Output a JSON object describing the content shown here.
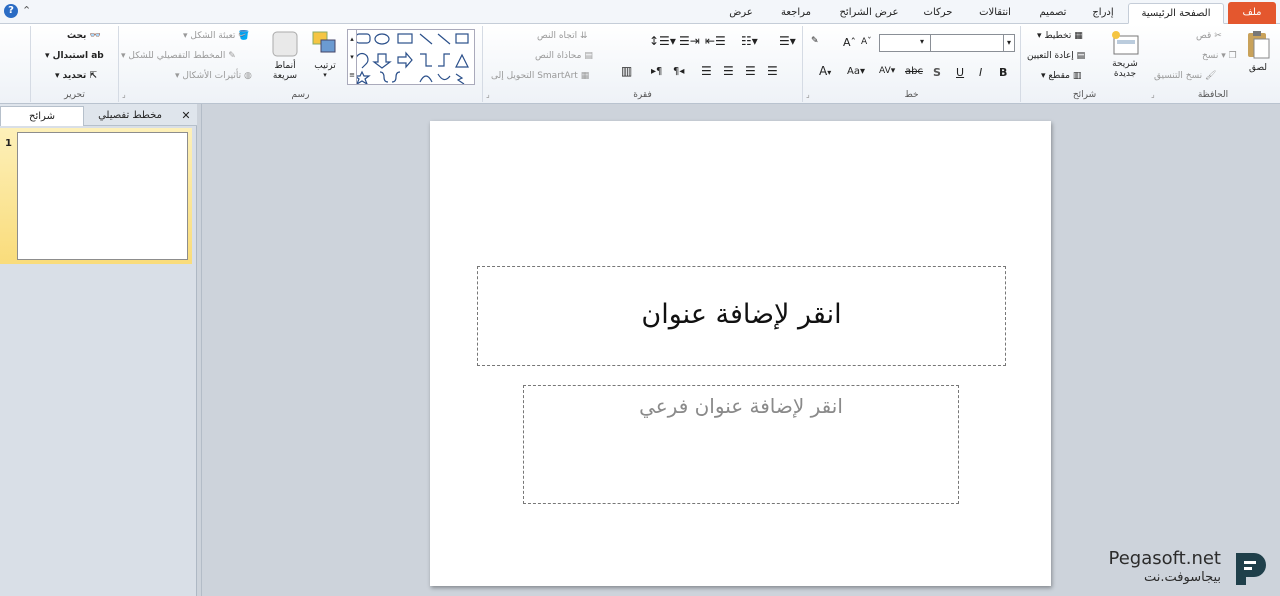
{
  "tabs": [
    "ملف",
    "الصفحة الرئيسية",
    "إدراج",
    "تصميم",
    "انتقالات",
    "حركات",
    "عرض الشرائح",
    "مراجعة",
    "عرض"
  ],
  "clipboard": {
    "paste": "لصق",
    "cut": "قص",
    "copy": "نسخ",
    "format_painter": "نسخ التنسيق",
    "label": "الحافظة"
  },
  "slides_group": {
    "new_slide": "شريحة جديدة",
    "layout": "تخطيط",
    "reset": "إعادة التعيين",
    "section": "مقطع",
    "label": "شرائح"
  },
  "font_group": {
    "label": "خط",
    "bold": "B",
    "italic": "I",
    "underline": "U",
    "shadow": "S",
    "strike": "abc",
    "spacing": "AV",
    "case": "Aa",
    "grow": "A",
    "shrink": "A"
  },
  "paragraph_group": {
    "label": "فقرة",
    "text_direction": "اتجاه النص",
    "align_text": "محاذاة النص",
    "smartart": "التحويل إلى SmartArt"
  },
  "drawing_group": {
    "label": "رسم",
    "arrange": "ترتيب",
    "quick_styles": "أنماط سريعة",
    "shape_fill": "تعبئة الشكل",
    "shape_outline": "المخطط التفصيلي للشكل",
    "shape_effects": "تأثيرات الأشكال"
  },
  "editing_group": {
    "label": "تحرير",
    "find": "بحث",
    "replace": "استبدال",
    "select": "تحديد"
  },
  "panel": {
    "tab_slides": "شرائح",
    "tab_outline": "مخطط تفصيلي",
    "close": "✕",
    "slide_number": "1"
  },
  "slide": {
    "title_placeholder": "انقر لإضافة عنوان",
    "subtitle_placeholder": "انقر لإضافة عنوان فرعي"
  },
  "watermark": {
    "line1": "Pegasoft.net",
    "line2": "بيجاسوفت.نت"
  },
  "colors": {
    "accent": "#e4572e",
    "help": "#2b6cc4",
    "selection": "#f9dc7b"
  }
}
